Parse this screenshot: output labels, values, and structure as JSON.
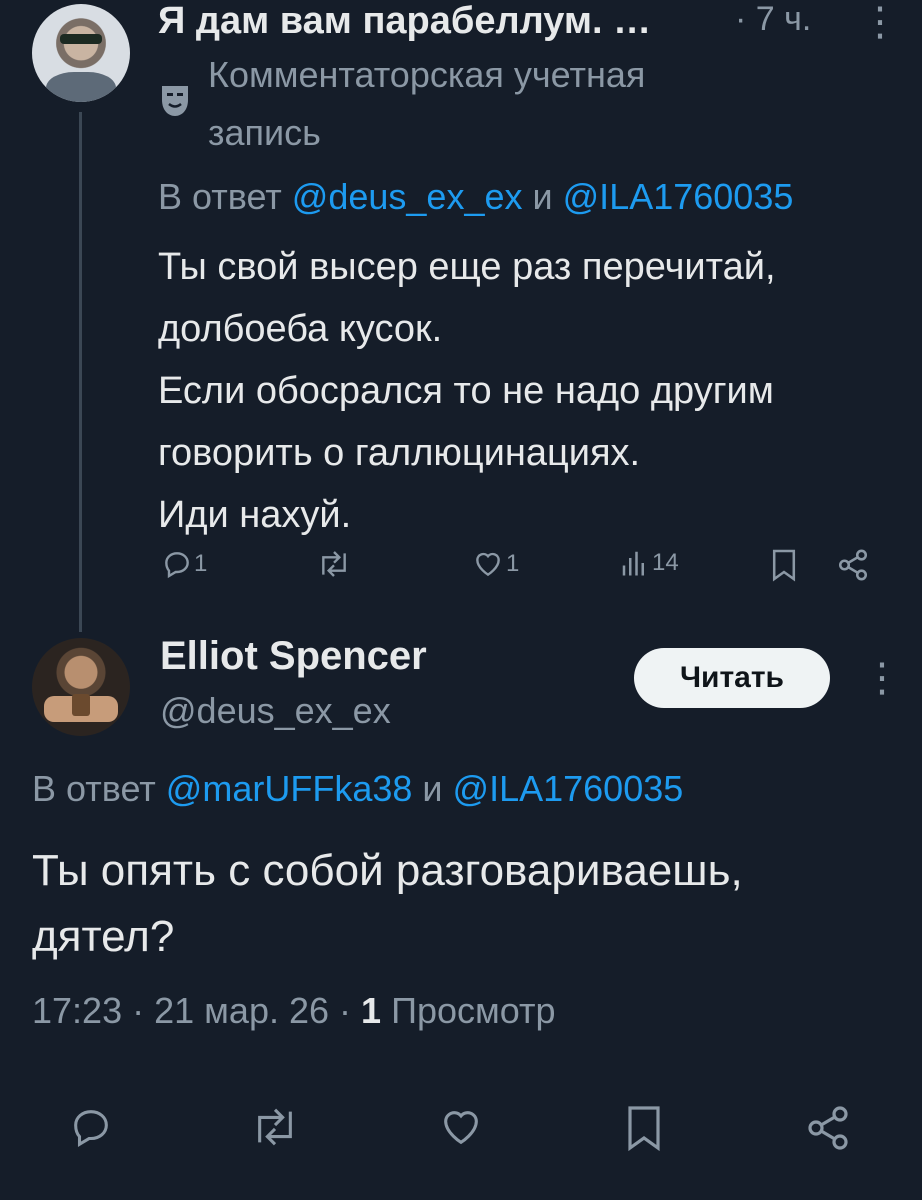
{
  "reply": {
    "author_name": "Я дам вам парабеллум. …",
    "time": "· 7 ч.",
    "more_icon": "more-vertical-icon",
    "badge_icon": "mask-icon",
    "badge_line1": "Комментаторская учетная",
    "badge_line2": "запись",
    "reply_prefix": "В ответ",
    "mention1": "@deus_ex_ex",
    "reply_and": "и",
    "mention2": "@ILA1760035",
    "lines": [
      "Ты свой высер еще раз перечитай,",
      "долбоеба кусок.",
      "Если обосрался то не надо другим",
      "говорить о галлюцинациях.",
      "Иди нахуй."
    ],
    "replies_count": "1",
    "likes_count": "1",
    "views_count": "14"
  },
  "tweet": {
    "author_name": "Elliot Spencer",
    "handle": "@deus_ex_ex",
    "follow_label": "Читать",
    "reply_prefix": "В ответ",
    "mention1": "@marUFFka38",
    "reply_and": "и",
    "mention2": "@ILA1760035",
    "lines": [
      "Ты опять с собой разговариваешь,",
      "дятел?"
    ],
    "time": "17:23",
    "sep1": "·",
    "date": "21 мар. 26",
    "sep2": "·",
    "views_count": "1",
    "views_label": "Просмотр"
  },
  "colors": {
    "background": "#151d29",
    "text": "#e7e9ea",
    "muted": "#8b98a5",
    "link": "#1d9bf0"
  }
}
